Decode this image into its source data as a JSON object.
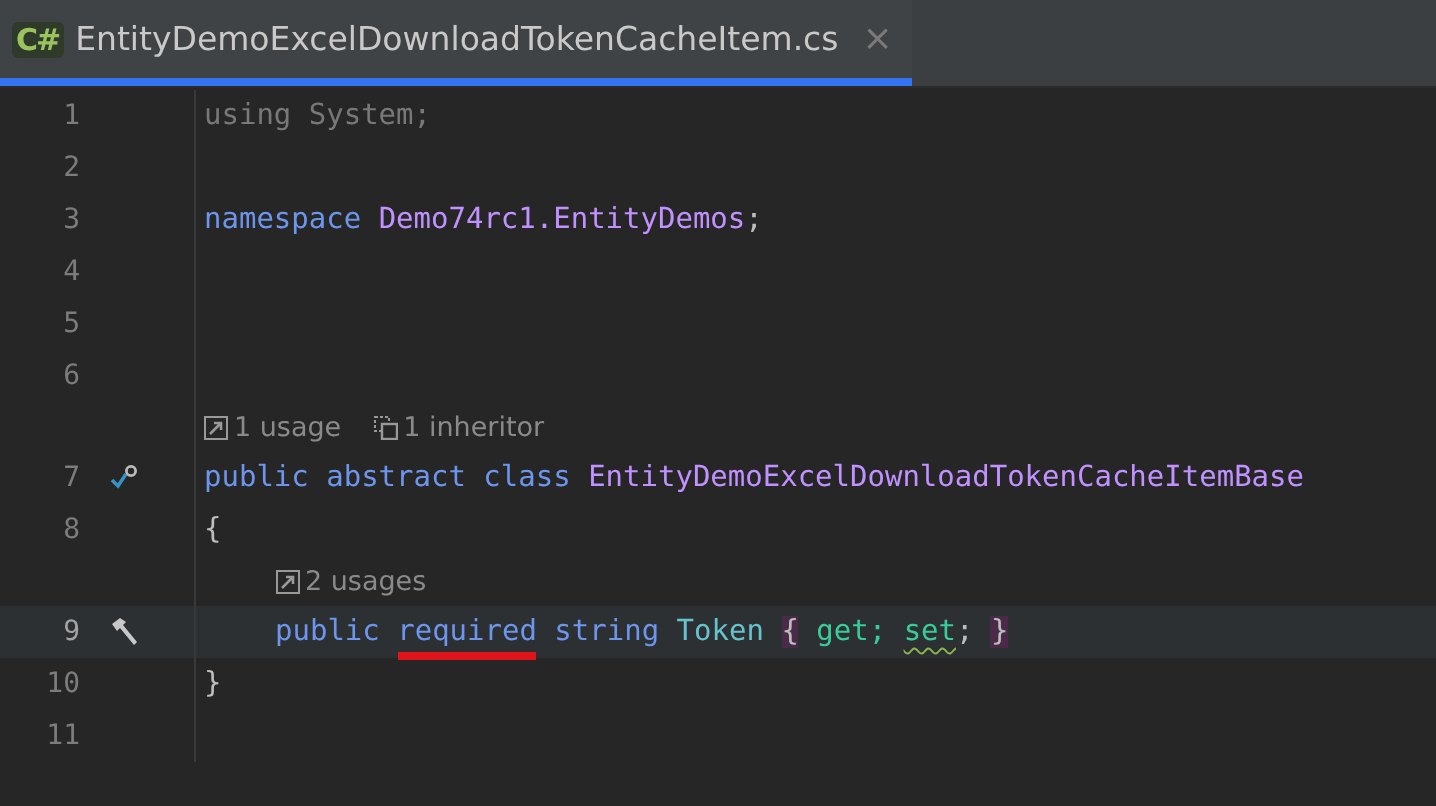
{
  "tab": {
    "lang_badge": "C#",
    "title": "EntityDemoExcelDownloadTokenCacheItem.cs",
    "close": "×",
    "selected": true
  },
  "rows": [
    {
      "kind": "code",
      "number": "1",
      "current": false,
      "tokens": [
        {
          "text": "using System;",
          "kind": "unused",
          "matched": false,
          "warning": false,
          "underlined": false
        }
      ]
    },
    {
      "kind": "code",
      "number": "2",
      "current": false,
      "tokens": []
    },
    {
      "kind": "code",
      "number": "3",
      "current": false,
      "tokens": [
        {
          "text": "namespace ",
          "kind": "keyword",
          "matched": false,
          "warning": false,
          "underlined": false
        },
        {
          "text": "Demo74rc1.EntityDemos",
          "kind": "namespace",
          "matched": false,
          "warning": false,
          "underlined": false
        },
        {
          "text": ";",
          "kind": "plain",
          "matched": false,
          "warning": false,
          "underlined": false
        }
      ]
    },
    {
      "kind": "code",
      "number": "4",
      "current": false,
      "tokens": []
    },
    {
      "kind": "code",
      "number": "5",
      "current": false,
      "tokens": []
    },
    {
      "kind": "code",
      "number": "6",
      "current": false,
      "tokens": []
    },
    {
      "kind": "hint",
      "hints": [
        {
          "kind": "usages",
          "text": "1 usage"
        },
        {
          "kind": "inheritors",
          "text": "1 inheritor"
        }
      ]
    },
    {
      "kind": "code",
      "number": "7",
      "current": false,
      "gutter": {
        "kind": "implemented"
      },
      "tokens": [
        {
          "text": "public abstract class ",
          "kind": "keyword",
          "matched": false,
          "warning": false,
          "underlined": false
        },
        {
          "text": "EntityDemoExcelDownloadTokenCacheItemBase",
          "kind": "class",
          "matched": false,
          "warning": false,
          "underlined": false
        }
      ]
    },
    {
      "kind": "code",
      "number": "8",
      "current": false,
      "tokens": [
        {
          "text": "{",
          "kind": "plain",
          "matched": false,
          "warning": false,
          "underlined": false
        }
      ],
      "children": [
        {
          "kind": "hint",
          "hints": [
            {
              "kind": "usages",
              "text": "2 usages"
            }
          ]
        },
        {
          "kind": "code",
          "number": "9",
          "current": true,
          "gutter": {
            "kind": "hammer"
          },
          "tokens": [
            {
              "text": "public ",
              "kind": "keyword",
              "matched": false,
              "warning": false,
              "underlined": false
            },
            {
              "text": "required",
              "kind": "keyword",
              "matched": false,
              "warning": false,
              "underlined": true
            },
            {
              "text": " string ",
              "kind": "keyword",
              "matched": false,
              "warning": false,
              "underlined": false
            },
            {
              "text": "Token ",
              "kind": "property",
              "matched": false,
              "warning": false,
              "underlined": false
            },
            {
              "text": "{",
              "kind": "plain",
              "matched": true,
              "warning": false,
              "underlined": false
            },
            {
              "text": " get; ",
              "kind": "accessor",
              "matched": false,
              "warning": false,
              "underlined": false
            },
            {
              "text": "set",
              "kind": "accessor",
              "matched": false,
              "warning": true,
              "underlined": false
            },
            {
              "text": "; ",
              "kind": "plain",
              "matched": false,
              "warning": false,
              "underlined": false
            },
            {
              "text": "}",
              "kind": "plain",
              "matched": true,
              "warning": false,
              "underlined": false
            }
          ]
        }
      ]
    },
    {
      "kind": "code",
      "number": "10",
      "current": false,
      "tokens": [
        {
          "text": "}",
          "kind": "plain",
          "matched": false,
          "warning": false,
          "underlined": false
        }
      ]
    },
    {
      "kind": "code",
      "number": "11",
      "current": false,
      "tokens": []
    }
  ]
}
